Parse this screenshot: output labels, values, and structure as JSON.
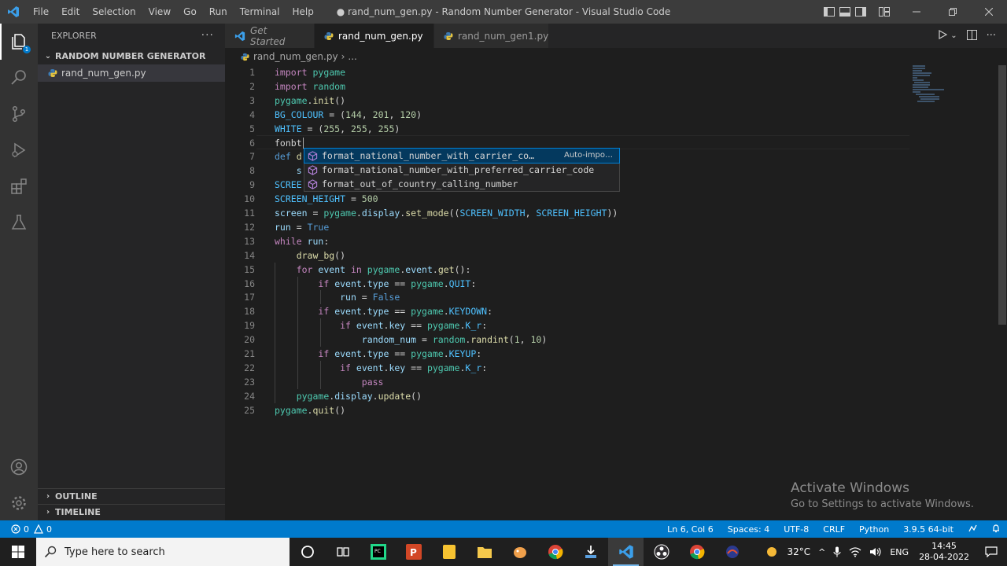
{
  "window": {
    "title": "● rand_num_gen.py - Random Number Generator - Visual Studio Code",
    "menu": [
      "File",
      "Edit",
      "Selection",
      "View",
      "Go",
      "Run",
      "Terminal",
      "Help"
    ]
  },
  "sidebar": {
    "header": "EXPLORER",
    "more": "···",
    "folder": "RANDOM NUMBER GENERATOR",
    "file": "rand_num_gen.py",
    "outline": "OUTLINE",
    "timeline": "TIMELINE"
  },
  "tabs": [
    {
      "label": "Get Started",
      "icon": "vscode-icon"
    },
    {
      "label": "rand_num_gen.py",
      "icon": "python-icon"
    },
    {
      "label": "rand_num_gen1.py",
      "icon": "python-icon"
    }
  ],
  "breadcrumb": {
    "file": "rand_num_gen.py",
    "sep": "›",
    "rest": "..."
  },
  "editor": {
    "line_numbers": [
      "1",
      "2",
      "3",
      "4",
      "5",
      "6",
      "7",
      "8",
      "9",
      "10",
      "11",
      "12",
      "13",
      "14",
      "15",
      "16",
      "17",
      "18",
      "19",
      "20",
      "21",
      "22",
      "23",
      "24",
      "25"
    ],
    "lines": [
      [
        {
          "t": "import",
          "c": "kw"
        },
        {
          "t": " "
        },
        {
          "t": "pygame",
          "c": "mod"
        }
      ],
      [
        {
          "t": "import",
          "c": "kw"
        },
        {
          "t": " "
        },
        {
          "t": "random",
          "c": "mod"
        }
      ],
      [
        {
          "t": "pygame",
          "c": "mod"
        },
        {
          "t": "."
        },
        {
          "t": "init",
          "c": "fn"
        },
        {
          "t": "()"
        }
      ],
      [
        {
          "t": "BG_COLOUR",
          "c": "const"
        },
        {
          "t": " = ("
        },
        {
          "t": "144",
          "c": "num"
        },
        {
          "t": ", "
        },
        {
          "t": "201",
          "c": "num"
        },
        {
          "t": ", "
        },
        {
          "t": "120",
          "c": "num"
        },
        {
          "t": ")"
        }
      ],
      [
        {
          "t": "WHITE",
          "c": "const"
        },
        {
          "t": " = ("
        },
        {
          "t": "255",
          "c": "num"
        },
        {
          "t": ", "
        },
        {
          "t": "255",
          "c": "num"
        },
        {
          "t": ", "
        },
        {
          "t": "255",
          "c": "num"
        },
        {
          "t": ")"
        }
      ],
      [
        {
          "t": "fonbt",
          "c": "plain"
        }
      ],
      [
        {
          "t": "def",
          "c": "bool"
        },
        {
          "t": " "
        },
        {
          "t": "d",
          "c": "fn"
        }
      ],
      [
        {
          "t": "    "
        },
        {
          "t": "s",
          "c": "var"
        }
      ],
      [
        {
          "t": "SCREE",
          "c": "const"
        }
      ],
      [
        {
          "t": "SCREEN_HEIGHT",
          "c": "const"
        },
        {
          "t": " = "
        },
        {
          "t": "500",
          "c": "num"
        }
      ],
      [
        {
          "t": "screen",
          "c": "var"
        },
        {
          "t": " = "
        },
        {
          "t": "pygame",
          "c": "mod"
        },
        {
          "t": "."
        },
        {
          "t": "display",
          "c": "var"
        },
        {
          "t": "."
        },
        {
          "t": "set_mode",
          "c": "fn"
        },
        {
          "t": "(("
        },
        {
          "t": "SCREEN_WIDTH",
          "c": "const"
        },
        {
          "t": ", "
        },
        {
          "t": "SCREEN_HEIGHT",
          "c": "const"
        },
        {
          "t": "))"
        }
      ],
      [
        {
          "t": "run",
          "c": "var"
        },
        {
          "t": " = "
        },
        {
          "t": "True",
          "c": "bool"
        }
      ],
      [
        {
          "t": "while",
          "c": "kw"
        },
        {
          "t": " "
        },
        {
          "t": "run",
          "c": "var"
        },
        {
          "t": ":"
        }
      ],
      [
        {
          "t": "    "
        },
        {
          "t": "draw_bg",
          "c": "fn"
        },
        {
          "t": "()"
        }
      ],
      [
        {
          "t": "    "
        },
        {
          "t": "for",
          "c": "kw"
        },
        {
          "t": " "
        },
        {
          "t": "event",
          "c": "var"
        },
        {
          "t": " "
        },
        {
          "t": "in",
          "c": "kw"
        },
        {
          "t": " "
        },
        {
          "t": "pygame",
          "c": "mod"
        },
        {
          "t": "."
        },
        {
          "t": "event",
          "c": "var"
        },
        {
          "t": "."
        },
        {
          "t": "get",
          "c": "fn"
        },
        {
          "t": "():"
        }
      ],
      [
        {
          "t": "        "
        },
        {
          "t": "if",
          "c": "kw"
        },
        {
          "t": " "
        },
        {
          "t": "event",
          "c": "var"
        },
        {
          "t": "."
        },
        {
          "t": "type",
          "c": "var"
        },
        {
          "t": " == "
        },
        {
          "t": "pygame",
          "c": "mod"
        },
        {
          "t": "."
        },
        {
          "t": "QUIT",
          "c": "const"
        },
        {
          "t": ":"
        }
      ],
      [
        {
          "t": "            "
        },
        {
          "t": "run",
          "c": "var"
        },
        {
          "t": " = "
        },
        {
          "t": "False",
          "c": "bool"
        }
      ],
      [
        {
          "t": "        "
        },
        {
          "t": "if",
          "c": "kw"
        },
        {
          "t": " "
        },
        {
          "t": "event",
          "c": "var"
        },
        {
          "t": "."
        },
        {
          "t": "type",
          "c": "var"
        },
        {
          "t": " == "
        },
        {
          "t": "pygame",
          "c": "mod"
        },
        {
          "t": "."
        },
        {
          "t": "KEYDOWN",
          "c": "const"
        },
        {
          "t": ":"
        }
      ],
      [
        {
          "t": "            "
        },
        {
          "t": "if",
          "c": "kw"
        },
        {
          "t": " "
        },
        {
          "t": "event",
          "c": "var"
        },
        {
          "t": "."
        },
        {
          "t": "key",
          "c": "var"
        },
        {
          "t": " == "
        },
        {
          "t": "pygame",
          "c": "mod"
        },
        {
          "t": "."
        },
        {
          "t": "K_r",
          "c": "const"
        },
        {
          "t": ":"
        }
      ],
      [
        {
          "t": "                "
        },
        {
          "t": "random_num",
          "c": "var"
        },
        {
          "t": " = "
        },
        {
          "t": "random",
          "c": "mod"
        },
        {
          "t": "."
        },
        {
          "t": "randint",
          "c": "fn"
        },
        {
          "t": "("
        },
        {
          "t": "1",
          "c": "num"
        },
        {
          "t": ", "
        },
        {
          "t": "10",
          "c": "num"
        },
        {
          "t": ")"
        }
      ],
      [
        {
          "t": "        "
        },
        {
          "t": "if",
          "c": "kw"
        },
        {
          "t": " "
        },
        {
          "t": "event",
          "c": "var"
        },
        {
          "t": "."
        },
        {
          "t": "type",
          "c": "var"
        },
        {
          "t": " == "
        },
        {
          "t": "pygame",
          "c": "mod"
        },
        {
          "t": "."
        },
        {
          "t": "KEYUP",
          "c": "const"
        },
        {
          "t": ":"
        }
      ],
      [
        {
          "t": "            "
        },
        {
          "t": "if",
          "c": "kw"
        },
        {
          "t": " "
        },
        {
          "t": "event",
          "c": "var"
        },
        {
          "t": "."
        },
        {
          "t": "key",
          "c": "var"
        },
        {
          "t": " == "
        },
        {
          "t": "pygame",
          "c": "mod"
        },
        {
          "t": "."
        },
        {
          "t": "K_r",
          "c": "const"
        },
        {
          "t": ":"
        }
      ],
      [
        {
          "t": "                "
        },
        {
          "t": "pass",
          "c": "kw"
        }
      ],
      [
        {
          "t": "    "
        },
        {
          "t": "pygame",
          "c": "mod"
        },
        {
          "t": "."
        },
        {
          "t": "display",
          "c": "var"
        },
        {
          "t": "."
        },
        {
          "t": "update",
          "c": "fn"
        },
        {
          "t": "()"
        }
      ],
      [
        {
          "t": "pygame",
          "c": "mod"
        },
        {
          "t": "."
        },
        {
          "t": "quit",
          "c": "fn"
        },
        {
          "t": "()"
        }
      ]
    ]
  },
  "suggest": {
    "items": [
      "format_national_number_with_carrier_co…",
      "format_national_number_with_preferred_carrier_code",
      "format_out_of_country_calling_number"
    ],
    "detail": "Auto-impo…"
  },
  "watermark": {
    "title": "Activate Windows",
    "subtitle": "Go to Settings to activate Windows."
  },
  "statusbar": {
    "errors": "0",
    "warnings": "0",
    "position": "Ln 6, Col 6",
    "spaces": "Spaces: 4",
    "encoding": "UTF-8",
    "eol": "CRLF",
    "language": "Python",
    "interpreter": "3.9.5 64-bit"
  },
  "taskbar": {
    "search_placeholder": "Type here to search",
    "temperature": "32°C",
    "language": "ENG",
    "time": "14:45",
    "date": "28-04-2022"
  },
  "colors": {
    "accent": "#007acc",
    "editor_bg": "#1e1e1e",
    "sidebar_bg": "#252526"
  }
}
